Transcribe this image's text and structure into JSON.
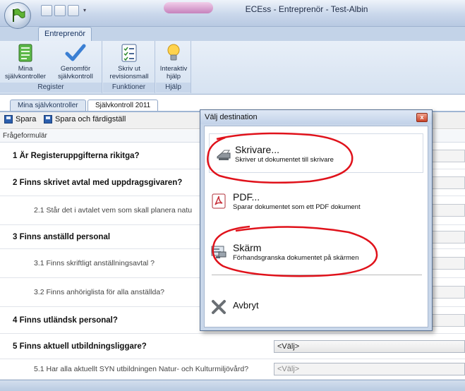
{
  "window": {
    "title": "ECEss - Entreprenör - Test-Albin"
  },
  "ribbon": {
    "tab_label": "Entreprenör",
    "groups": [
      {
        "label": "Register",
        "buttons": [
          {
            "label_l1": "Mina",
            "label_l2": "självkontroller",
            "icon": "list-icon"
          },
          {
            "label_l1": "Genomför",
            "label_l2": "självkontroll",
            "icon": "checkmark-icon"
          }
        ]
      },
      {
        "label": "Funktioner",
        "buttons": [
          {
            "label_l1": "Skriv ut",
            "label_l2": "revisionsmall",
            "icon": "print-list-icon"
          }
        ]
      },
      {
        "label": "Hjälp",
        "buttons": [
          {
            "label_l1": "Interaktiv",
            "label_l2": "hjälp",
            "icon": "lightbulb-icon"
          }
        ]
      }
    ]
  },
  "doc_tabs": [
    "Mina självkontroller",
    "Självkontroll 2011"
  ],
  "toolbar": {
    "save": "Spara",
    "save_finish": "Spara och färdigställ"
  },
  "form": {
    "header": "Frågeformulär",
    "rows": [
      {
        "text": "1 Är Registeruppgifterna rikitga?",
        "kind": "main"
      },
      {
        "text": "2 Finns skrivet avtal med uppdragsgivaren?",
        "kind": "main"
      },
      {
        "text": "2.1 Står det i avtalet vem som skall planera natu",
        "kind": "sub"
      },
      {
        "text": "3 Finns anställd personal",
        "kind": "main"
      },
      {
        "text": "3.1 Finns skriftligt anställningsavtal ?",
        "kind": "sub"
      },
      {
        "text": "3.2 Finns anhöriglista för alla anställda?",
        "kind": "sub"
      },
      {
        "text": "4 Finns utländsk personal?",
        "kind": "main"
      },
      {
        "text": "5 Finns aktuell utbildningsliggare?",
        "kind": "main",
        "select": "<Välj>"
      },
      {
        "text": "5.1 Har alla aktuellt SYN utbildningen  Natur- och Kulturmiljövård?",
        "kind": "sub",
        "select": "<Välj>"
      }
    ]
  },
  "dialog": {
    "title": "Välj destination",
    "close_glyph": "x",
    "options": [
      {
        "head": "Skrivare...",
        "desc": "Skriver ut dokumentet till skrivare",
        "icon": "printer-icon"
      },
      {
        "head": "PDF...",
        "desc": "Sparar dokumentet som ett PDF dokument",
        "icon": "pdf-icon"
      },
      {
        "head": "Skärm",
        "desc": "Förhandsgranska dokumentet på skärmen",
        "icon": "screen-preview-icon"
      },
      {
        "head": "Avbryt",
        "icon": "cancel-x-icon"
      }
    ]
  },
  "colors": {
    "annotation_red": "#e0121b",
    "ribbon_blue": "#c3d3e8"
  }
}
